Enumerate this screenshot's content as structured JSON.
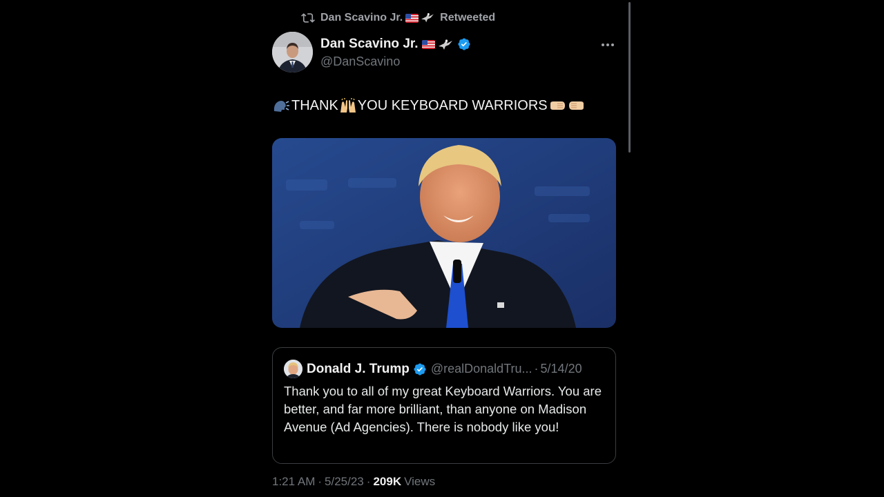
{
  "retweet_banner": {
    "retweeter": "Dan Scavino Jr.",
    "action": "Retweeted",
    "icons": [
      "retweet-icon",
      "us-flag-icon",
      "eagle-icon"
    ]
  },
  "author": {
    "name": "Dan Scavino Jr.",
    "handle": "@DanScavino",
    "verified": true,
    "icons": [
      "us-flag-icon",
      "eagle-icon",
      "verified-badge-icon",
      "more-options-icon"
    ]
  },
  "tweet": {
    "text_part1": "THANK",
    "text_part2": "YOU KEYBOARD WARRIORS",
    "emojis": [
      "speaking-head-icon",
      "raising-hands-icon",
      "fist-left-icon",
      "fist-right-icon"
    ]
  },
  "media": {
    "kind": "photo"
  },
  "quoted_tweet": {
    "author_name": "Donald J. Trump",
    "handle": "@realDonaldTru...",
    "separator": "·",
    "date": "5/14/20",
    "verified": true,
    "text": "Thank you to all of my great Keyboard Warriors. You are better, and far more brilliant, than anyone on Madison Avenue (Ad Agencies). There is nobody like you!"
  },
  "meta": {
    "time": "1:21 AM",
    "separator": "·",
    "date": "5/25/23",
    "views_count": "209K",
    "views_label": "Views"
  },
  "colors": {
    "background": "#000000",
    "text_primary": "#e7e9ea",
    "text_secondary": "#71767b",
    "verified_blue": "#1d9bf0",
    "border": "#3a3d41"
  }
}
